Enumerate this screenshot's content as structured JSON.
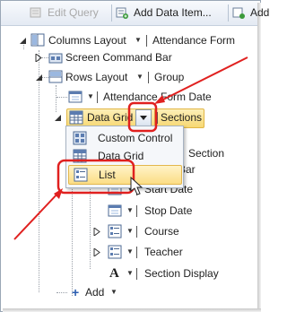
{
  "toolbar": {
    "edit_query": "Edit Query",
    "add_data_item": "Add Data Item...",
    "add_cut": "Add"
  },
  "tree": {
    "columns_layout": "Columns Layout",
    "attendance_form": "Attendance Form",
    "screen_command_bar": "Screen Command Bar",
    "rows_layout": "Rows Layout",
    "group": "Group",
    "attendance_form_date": "Attendance Form Date",
    "data_grid": "Data Grid",
    "sections": "Sections",
    "section_cut": "Section",
    "bar_cut": "Bar",
    "start_date": "Start Date",
    "stop_date": "Stop Date",
    "course": "Course",
    "teacher": "Teacher",
    "section_display": "Section Display",
    "add": "Add"
  },
  "menu": {
    "items": [
      "Custom Control",
      "Data Grid",
      "List"
    ],
    "highlighted": "List"
  },
  "colors": {
    "annotation_red": "#e0201f",
    "selection_gold": "#f7d873",
    "add_plus_blue": "#2a5db0"
  },
  "icons": {
    "edit_query": "edit-query-icon",
    "add_data_item": "add-data-item-icon",
    "columns_layout": "columns-layout-icon",
    "rows_layout": "rows-layout-icon",
    "data_grid": "data-grid-icon",
    "date_field": "calendar-icon",
    "list_field": "list-icon",
    "text_field": "text-A-icon"
  }
}
